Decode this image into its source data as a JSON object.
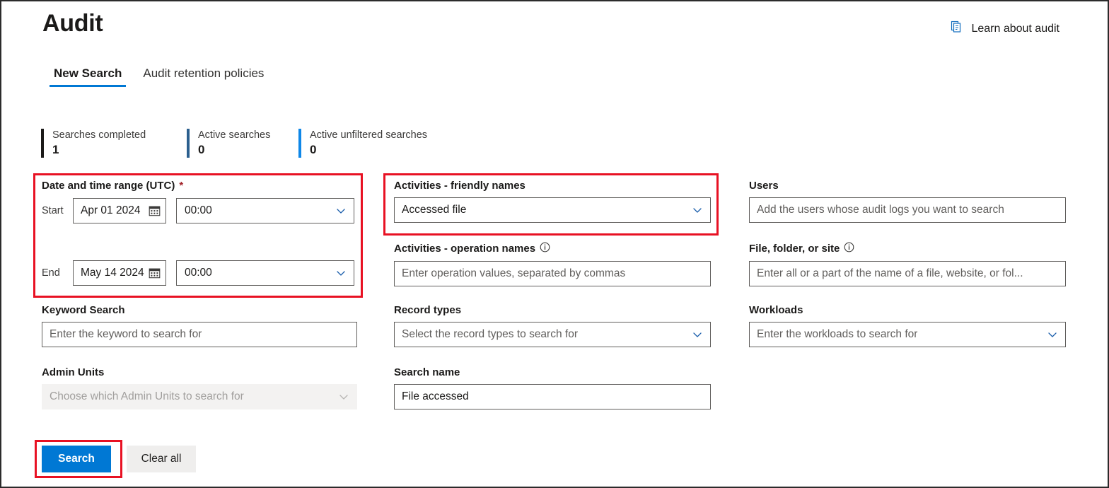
{
  "header": {
    "title": "Audit",
    "learn_link": {
      "label": "Learn about audit",
      "icon": "documents-icon"
    }
  },
  "tabs": [
    {
      "label": "New Search",
      "active": true
    },
    {
      "label": "Audit retention policies",
      "active": false
    }
  ],
  "stats": [
    {
      "label": "Searches completed",
      "value": "1",
      "bar_color": "#1b1a19"
    },
    {
      "label": "Active searches",
      "value": "0",
      "bar_color": "#2b5f8e"
    },
    {
      "label": "Active unfiltered searches",
      "value": "0",
      "bar_color": "#0f87e8"
    }
  ],
  "form": {
    "date_range": {
      "label": "Date and time range (UTC)",
      "required_marker": "*",
      "start": {
        "legend": "Start",
        "date_value": "Apr 01 2024",
        "time_value": "00:00"
      },
      "end": {
        "legend": "End",
        "date_value": "May 14 2024",
        "time_value": "00:00"
      }
    },
    "keyword_search": {
      "label": "Keyword Search",
      "placeholder": "Enter the keyword to search for",
      "value": ""
    },
    "admin_units": {
      "label": "Admin Units",
      "placeholder": "Choose which Admin Units to search for",
      "value": "",
      "disabled": true
    },
    "activities_friendly": {
      "label": "Activities - friendly names",
      "value": "Accessed file"
    },
    "activities_operation": {
      "label": "Activities - operation names",
      "info_icon": "info-icon",
      "placeholder": "Enter operation values, separated by commas",
      "value": ""
    },
    "record_types": {
      "label": "Record types",
      "placeholder": "Select the record types to search for",
      "value": ""
    },
    "search_name": {
      "label": "Search name",
      "value": "File accessed"
    },
    "users": {
      "label": "Users",
      "placeholder": "Add the users whose audit logs you want to search",
      "value": ""
    },
    "file_folder_site": {
      "label": "File, folder, or site",
      "info_icon": "info-icon",
      "placeholder": "Enter all or a part of the name of a file, website, or fol...",
      "value": ""
    },
    "workloads": {
      "label": "Workloads",
      "placeholder": "Enter the workloads to search for",
      "value": ""
    }
  },
  "buttons": {
    "search": "Search",
    "clear_all": "Clear all"
  },
  "colors": {
    "accent": "#0078d4",
    "annotation": "#e81123",
    "required": "#a4262c"
  }
}
